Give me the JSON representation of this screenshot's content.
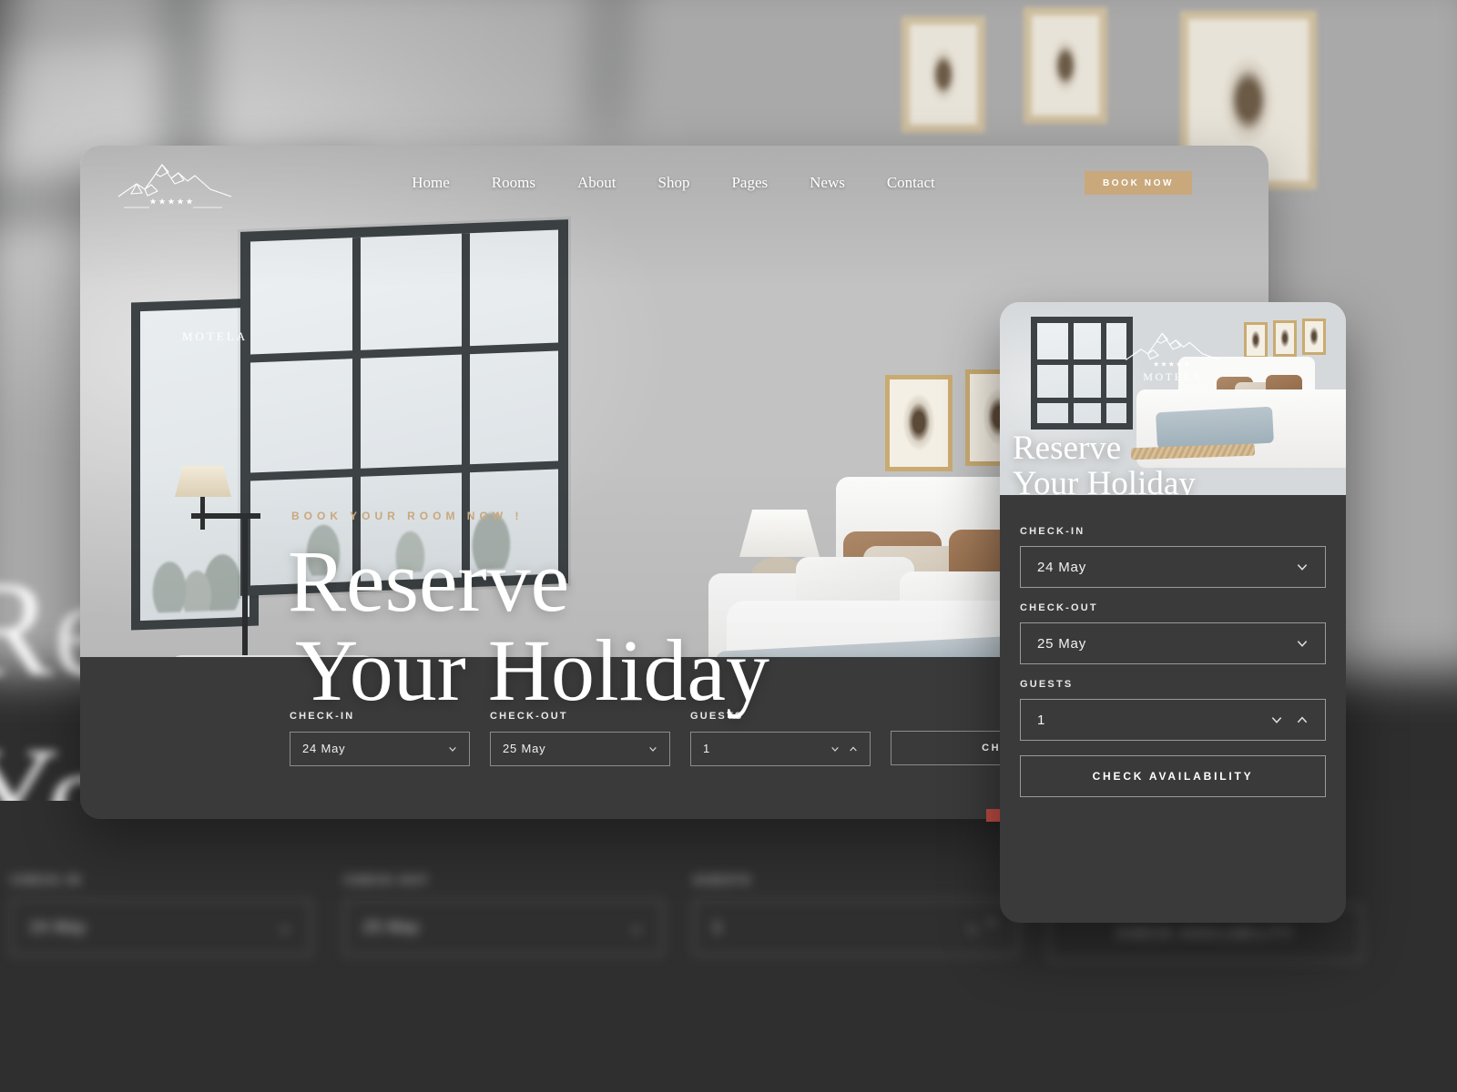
{
  "brand": {
    "name": "MOTELA",
    "stars": 5,
    "logo_icon": "mountain-logo-icon"
  },
  "nav": {
    "items": [
      {
        "label": "Home"
      },
      {
        "label": "Rooms"
      },
      {
        "label": "About"
      },
      {
        "label": "Shop"
      },
      {
        "label": "Pages"
      },
      {
        "label": "News"
      },
      {
        "label": "Contact"
      }
    ],
    "cta": {
      "label": "BOOK NOW",
      "color": "#c9a87c"
    }
  },
  "hero": {
    "eyebrow": "BOOK YOUR ROOM NOW !",
    "eyebrow_color": "#c9a87c",
    "title_line1": "Reserve",
    "title_line2": "Your Holiday"
  },
  "booking_form": {
    "checkin": {
      "label": "CHECK-IN",
      "value": "24 May",
      "icon": "chevron-down-icon"
    },
    "checkout": {
      "label": "CHECK-OUT",
      "value": "25 May",
      "icon": "chevron-down-icon"
    },
    "guests": {
      "label": "GUESTS",
      "value": "1",
      "icon_down": "chevron-down-icon",
      "icon_up": "chevron-up-icon"
    },
    "submit": {
      "label": "CHECK AVAILABILITY"
    }
  },
  "mobile_panel": {
    "hero": {
      "title_line1": "Reserve",
      "title_line2": "Your Holiday"
    },
    "checkin": {
      "label": "CHECK-IN",
      "value": "24 May",
      "icon": "chevron-down-icon"
    },
    "checkout": {
      "label": "CHECK-OUT",
      "value": "25 May",
      "icon": "chevron-down-icon"
    },
    "guests": {
      "label": "GUESTS",
      "value": "1",
      "icon_down": "chevron-down-icon",
      "icon_up": "chevron-up-icon"
    },
    "submit": {
      "label": "CHECK AVAILABILITY"
    }
  },
  "background": {
    "hero_words_line1": "Reserve",
    "hero_words_line2": "Your Holiday",
    "form": {
      "checkin_label": "CHECK-IN",
      "checkin_value": "24 May",
      "checkout_label": "CHECK-OUT",
      "checkout_value": "25 May",
      "guests_label": "GUESTS",
      "guests_value": "1",
      "submit_label": "CHECK AVAILABILITY"
    }
  },
  "colors": {
    "panel_dark": "#3a3a3a",
    "accent_gold": "#c9a87c",
    "slider_dot": "#bb4a42"
  }
}
